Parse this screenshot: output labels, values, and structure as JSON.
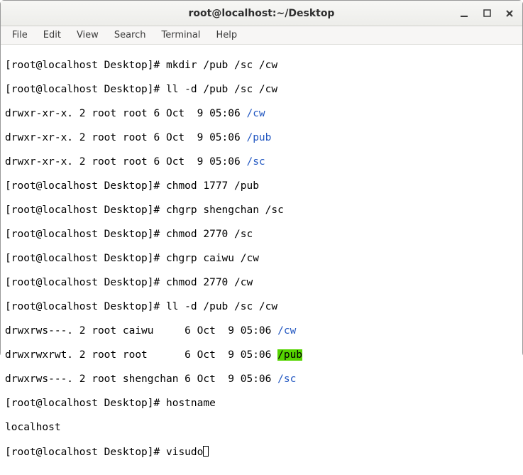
{
  "window": {
    "title": "root@localhost:~/Desktop"
  },
  "menu": {
    "file": "File",
    "edit": "Edit",
    "view": "View",
    "search": "Search",
    "terminal": "Terminal",
    "help": "Help"
  },
  "prompt": "[root@localhost Desktop]# ",
  "lines": {
    "l0_cmd": "mkdir /pub /sc /cw",
    "l1_cmd": "ll -d /pub /sc /cw",
    "l2": "drwxr-xr-x. 2 root root 6 Oct  9 05:06 ",
    "l2_dir": "/cw",
    "l3": "drwxr-xr-x. 2 root root 6 Oct  9 05:06 ",
    "l3_dir": "/pub",
    "l4": "drwxr-xr-x. 2 root root 6 Oct  9 05:06 ",
    "l4_dir": "/sc",
    "l5_cmd": "chmod 1777 /pub",
    "l6_cmd": "chgrp shengchan /sc",
    "l7_cmd": "chmod 2770 /sc",
    "l8_cmd": "chgrp caiwu /cw",
    "l9_cmd": "chmod 2770 /cw",
    "l10_cmd": "ll -d /pub /sc /cw",
    "l11": "drwxrws---. 2 root caiwu     6 Oct  9 05:06 ",
    "l11_dir": "/cw",
    "l12": "drwxrwxrwt. 2 root root      6 Oct  9 05:06 ",
    "l12_dir": "/pub",
    "l13": "drwxrws---. 2 root shengchan 6 Oct  9 05:06 ",
    "l13_dir": "/sc",
    "l14_cmd": "hostname",
    "l15": "localhost",
    "l16_cmd": "visudo"
  }
}
